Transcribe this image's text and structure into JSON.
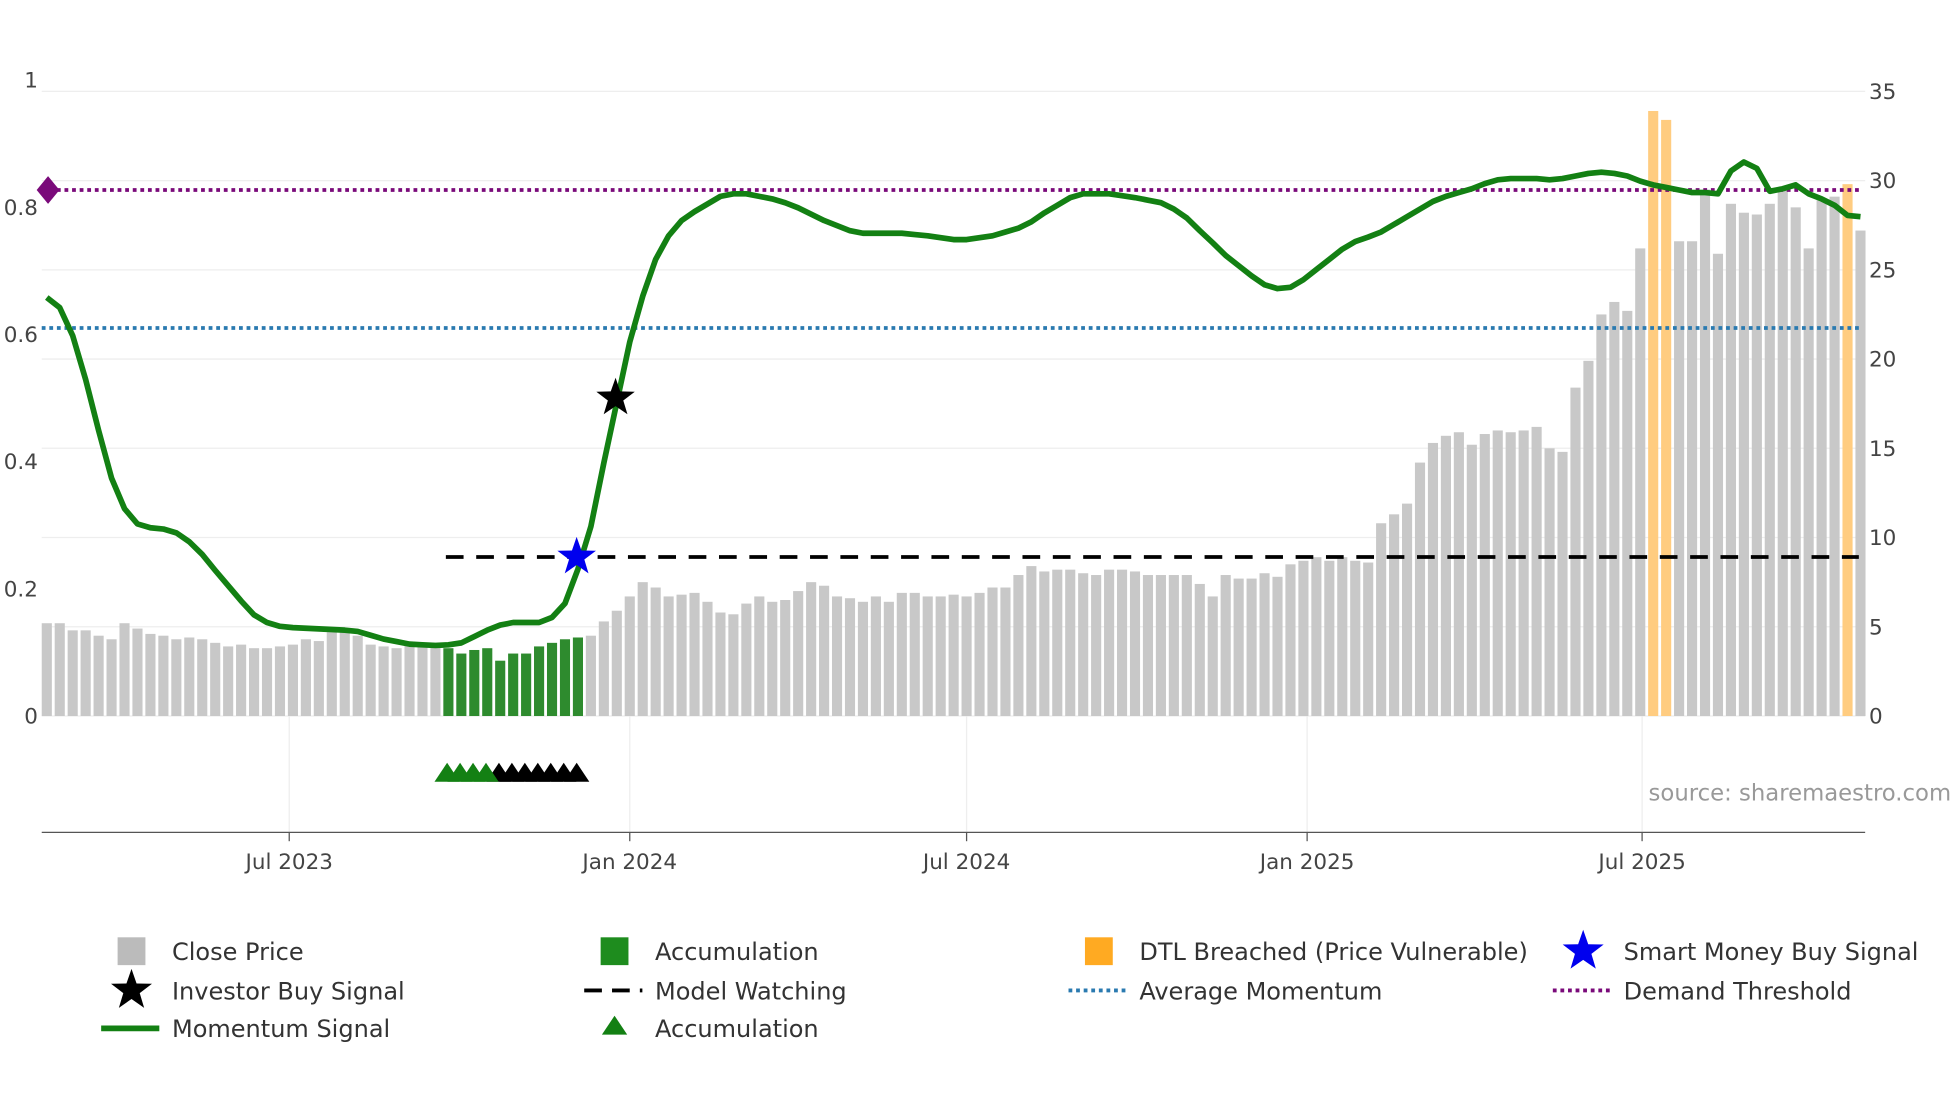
{
  "chart_data": {
    "type": "bar",
    "x_start": "2023-02-20",
    "frequency": "weekly",
    "x_ticks": [
      "Jul 2023",
      "Jan 2024",
      "Jul 2024",
      "Jan 2025",
      "Jul 2025"
    ],
    "x_tick_dates": [
      "2023-07-01",
      "2024-01-01",
      "2024-07-01",
      "2025-01-01",
      "2025-07-01"
    ],
    "y_left": {
      "range": [
        0,
        1
      ],
      "ticks": [
        "0",
        "0.2",
        "0.4",
        "0.6",
        "0.8",
        "1"
      ]
    },
    "y_right": {
      "range": [
        0,
        35
      ],
      "ticks": [
        "0",
        "5",
        "10",
        "15",
        "20",
        "25",
        "30",
        "35"
      ]
    },
    "grid": true,
    "legend_placement": "bottom",
    "source": "source: sharemaestro.com",
    "colors": {
      "close": "#c8c8c8",
      "accumulation": "#2e8b2e",
      "dtl": "#ffcc80",
      "momentum": "#138013",
      "avg": "#2a7ab0",
      "demand": "#7a0a7a",
      "watch": "#000000",
      "smart": "#0000ee"
    },
    "close_price": [
      5.2,
      5.2,
      4.8,
      4.8,
      4.5,
      4.3,
      5.2,
      4.9,
      4.6,
      4.5,
      4.3,
      4.4,
      4.3,
      4.1,
      3.9,
      4.0,
      3.8,
      3.8,
      3.9,
      4.0,
      4.3,
      4.2,
      4.7,
      4.7,
      4.5,
      4.0,
      3.9,
      3.8,
      4.0,
      4.0,
      3.9,
      3.8,
      3.5,
      3.7,
      3.8,
      3.1,
      3.5,
      3.5,
      3.9,
      4.1,
      4.3,
      4.4,
      4.5,
      5.3,
      5.9,
      6.7,
      7.5,
      7.2,
      6.7,
      6.8,
      6.9,
      6.4,
      5.8,
      5.7,
      6.3,
      6.7,
      6.4,
      6.5,
      7.0,
      7.5,
      7.3,
      6.7,
      6.6,
      6.4,
      6.7,
      6.4,
      6.9,
      6.9,
      6.7,
      6.7,
      6.8,
      6.7,
      6.9,
      7.2,
      7.2,
      7.9,
      8.4,
      8.1,
      8.2,
      8.2,
      8.0,
      7.9,
      8.2,
      8.2,
      8.1,
      7.9,
      7.9,
      7.9,
      7.9,
      7.4,
      6.7,
      7.9,
      7.7,
      7.7,
      8.0,
      7.8,
      8.5,
      8.7,
      8.9,
      8.7,
      8.9,
      8.7,
      8.6,
      10.8,
      11.3,
      11.9,
      14.2,
      15.3,
      15.7,
      15.9,
      15.2,
      15.8,
      16.0,
      15.9,
      16.0,
      16.2,
      15.0,
      14.8,
      18.4,
      19.9,
      22.5,
      23.2,
      22.7,
      26.2,
      33.9,
      33.4,
      26.6,
      26.6,
      29.5,
      25.9,
      28.7,
      28.2,
      28.1,
      28.7,
      29.5,
      28.5,
      26.2,
      28.9,
      29.1,
      29.8,
      27.2
    ],
    "accumulation_bar_weeks": [
      31,
      32,
      33,
      34,
      35,
      36,
      37,
      38,
      39,
      40,
      41
    ],
    "dtl_breached_weeks": [
      124,
      125,
      139
    ],
    "momentum": [
      0.658,
      0.642,
      0.598,
      0.529,
      0.449,
      0.374,
      0.326,
      0.302,
      0.296,
      0.294,
      0.288,
      0.274,
      0.254,
      0.229,
      0.205,
      0.181,
      0.159,
      0.147,
      0.141,
      0.139,
      0.138,
      0.137,
      0.136,
      0.135,
      0.133,
      0.127,
      0.121,
      0.117,
      0.113,
      0.112,
      0.111,
      0.112,
      0.115,
      0.125,
      0.135,
      0.143,
      0.147,
      0.147,
      0.147,
      0.155,
      0.177,
      0.231,
      0.298,
      0.398,
      0.493,
      0.588,
      0.66,
      0.718,
      0.755,
      0.779,
      0.793,
      0.805,
      0.817,
      0.821,
      0.821,
      0.817,
      0.813,
      0.807,
      0.799,
      0.789,
      0.779,
      0.771,
      0.763,
      0.759,
      0.759,
      0.759,
      0.759,
      0.757,
      0.755,
      0.752,
      0.749,
      0.749,
      0.752,
      0.755,
      0.761,
      0.767,
      0.777,
      0.791,
      0.803,
      0.815,
      0.821,
      0.821,
      0.821,
      0.818,
      0.815,
      0.811,
      0.807,
      0.797,
      0.783,
      0.763,
      0.744,
      0.724,
      0.708,
      0.692,
      0.678,
      0.672,
      0.674,
      0.686,
      0.702,
      0.718,
      0.734,
      0.746,
      0.753,
      0.761,
      0.773,
      0.785,
      0.797,
      0.809,
      0.817,
      0.823,
      0.829,
      0.837,
      0.843,
      0.845,
      0.845,
      0.845,
      0.843,
      0.845,
      0.849,
      0.853,
      0.855,
      0.853,
      0.849,
      0.841,
      0.835,
      0.831,
      0.827,
      0.823,
      0.823,
      0.821,
      0.857,
      0.871,
      0.861,
      0.825,
      0.829,
      0.835,
      0.821,
      0.813,
      0.803,
      0.787,
      0.785
    ],
    "average_momentum": 0.61,
    "demand_threshold": 0.827,
    "model_watching": {
      "start_week": 31,
      "value": 0.25
    },
    "investor_buy_signal": {
      "week": 44,
      "value": 0.5
    },
    "smart_money_buy_signal": {
      "week": 41,
      "value": 0.25
    },
    "accumulation_triangles": {
      "green_weeks": [
        31,
        32,
        33,
        34
      ],
      "black_weeks": [
        35,
        36,
        37,
        38,
        39,
        40,
        41
      ]
    },
    "legend": [
      "Close Price",
      "Accumulation",
      "DTL Breached (Price Vulnerable)",
      "Smart Money Buy Signal",
      "Investor Buy Signal",
      "Model Watching",
      "Average Momentum",
      "Demand Threshold",
      "Momentum Signal",
      "Accumulation"
    ]
  }
}
